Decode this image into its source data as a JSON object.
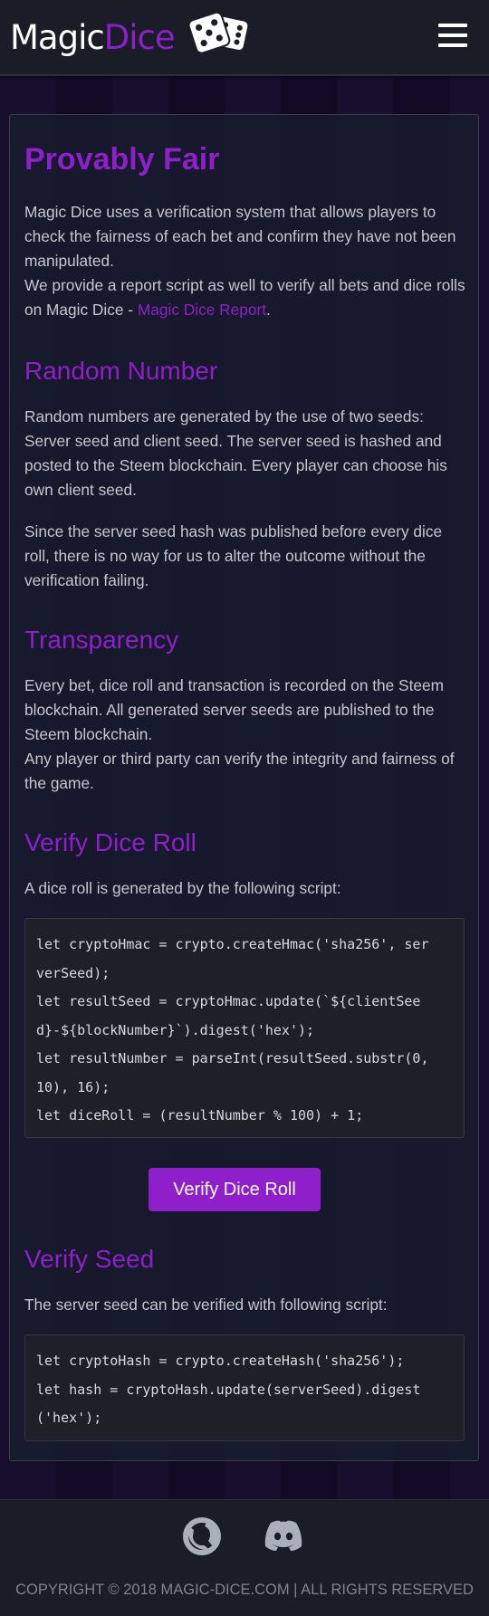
{
  "header": {
    "logo_part1": "Magic",
    "logo_part2": "Dice"
  },
  "colors": {
    "accent": "#8e1fcb",
    "header_bg": "#1a1c27",
    "page_bg": "#120a24",
    "code_bg": "#1b2029"
  },
  "icons": {
    "logo": "dice-pair-icon",
    "menu": "hamburger-menu-icon",
    "steem": "steem-icon",
    "discord": "discord-icon"
  },
  "main": {
    "title": "Provably Fair",
    "intro_p1": "Magic Dice uses a verification system that allows players to check the fairness of each bet and confirm they have not been manipulated.",
    "intro_p2": "We provide a report script as well to verify all bets and dice rolls on Magic Dice - ",
    "report_link": "Magic Dice Report",
    "intro_end": ".",
    "random": {
      "heading": "Random Number",
      "p1": "Random numbers are generated by the use of two seeds: Server seed and client seed. The server seed is hashed and posted to the Steem blockchain. Every player can choose his own client seed.",
      "p2": "Since the server seed hash was published before every dice roll, there is no way for us to alter the outcome without the verification failing."
    },
    "transparency": {
      "heading": "Transparency",
      "p1": "Every bet, dice roll and transaction is recorded on the Steem blockchain. All generated server seeds are published to the Steem blockchain.",
      "p2": "Any player or third party can verify the integrity and fairness of the game."
    },
    "verify_roll": {
      "heading": "Verify Dice Roll",
      "desc": "A dice roll is generated by the following script:",
      "code": "let cryptoHmac = crypto.createHmac('sha256', ser\nverSeed);\nlet resultSeed = cryptoHmac.update(`${clientSee\nd}-${blockNumber}`).digest('hex');\nlet resultNumber = parseInt(resultSeed.substr(0,\n10), 16);\nlet diceRoll = (resultNumber % 100) + 1;",
      "button_label": "Verify Dice Roll"
    },
    "verify_seed": {
      "heading": "Verify Seed",
      "desc": "The server seed can be verified with following script:",
      "code": "let cryptoHash = crypto.createHash('sha256');\nlet hash = cryptoHash.update(serverSeed).digest\n('hex');"
    }
  },
  "footer": {
    "copyright": "COPYRIGHT © 2018 MAGIC-DICE.COM | ALL RIGHTS RESERVED"
  }
}
